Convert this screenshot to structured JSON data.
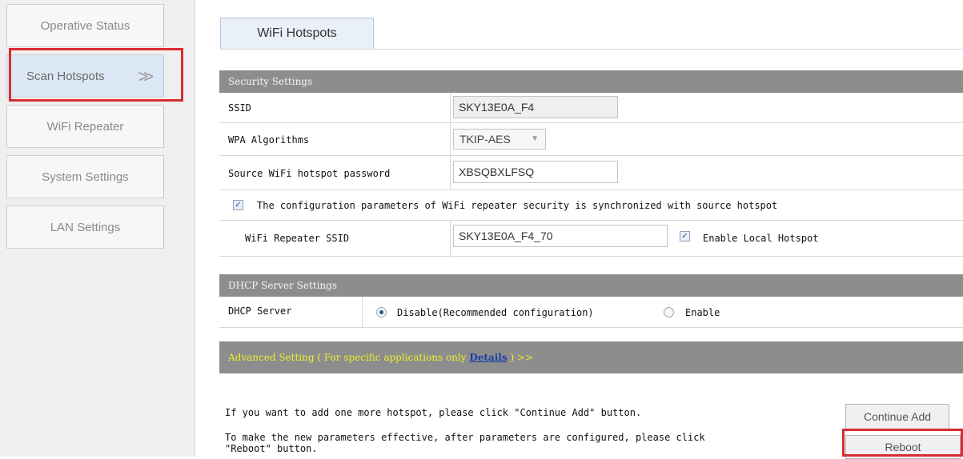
{
  "sidebar": {
    "items": [
      {
        "label": "Operative Status"
      },
      {
        "label": "Scan Hotspots",
        "arrow": ">>"
      },
      {
        "label": "WiFi Repeater"
      },
      {
        "label": "System Settings"
      },
      {
        "label": "LAN Settings"
      }
    ]
  },
  "tab": {
    "label": "WiFi Hotspots"
  },
  "security": {
    "header": "Security Settings",
    "ssid_label": "SSID",
    "ssid_value": "SKY13E0A_F4",
    "wpa_label": "WPA Algorithms",
    "wpa_value": "TKIP-AES",
    "password_label": "Source WiFi hotspot password",
    "password_value": "XBSQBXLFSQ",
    "sync_label": "The configuration parameters of WiFi repeater security is synchronized with source hotspot",
    "repeater_ssid_label": "WiFi Repeater SSID",
    "repeater_ssid_value": "SKY13E0A_F4_70",
    "local_hotspot_label": "Enable Local Hotspot"
  },
  "dhcp": {
    "header": "DHCP Server Settings",
    "server_label": "DHCP Server",
    "disable_label": "Disable(Recommended configuration)",
    "enable_label": "Enable"
  },
  "advanced": {
    "text_before": "Advanced Setting ( For specific applications only ",
    "details_link": "Details",
    "text_after": " ) >>"
  },
  "footer": {
    "add_hint": "If you want to add one more hotspot, please click \"Continue Add\" button.",
    "reboot_hint_1": "To make the new parameters effective, after parameters are configured, please click",
    "reboot_hint_2": "\"Reboot\" button.",
    "continue_add_label": "Continue Add",
    "reboot_label": "Reboot"
  },
  "colors": {
    "highlight": "#d92b32",
    "header_bg": "#8d8d8d",
    "advanced_text": "#ecef2a"
  }
}
